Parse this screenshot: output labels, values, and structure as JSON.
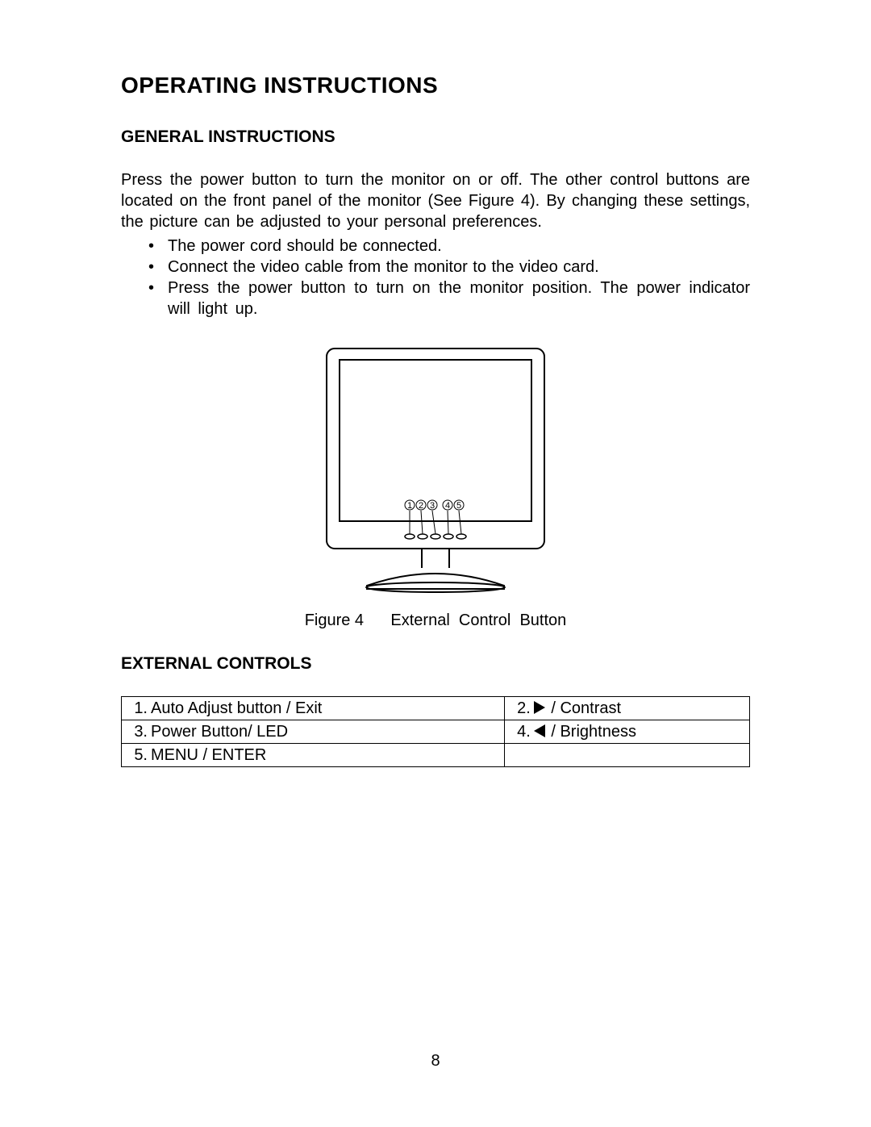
{
  "title": "OPERATING INSTRUCTIONS",
  "section1": {
    "heading": "GENERAL INSTRUCTIONS",
    "intro": "Press the power button to turn the monitor on or off. The other control buttons are located on the front panel of the monitor (See Figure 4). By changing these settings, the picture can be adjusted to your personal preferences.",
    "bullets": [
      "The power cord should be connected.",
      "Connect the video cable from the monitor to the video card.",
      "Press the power button to turn on the monitor position. The power indicator will light up."
    ]
  },
  "figure": {
    "caption": "Figure 4      External  Control  Button",
    "labels": [
      "1",
      "2",
      "3",
      "4",
      "5"
    ]
  },
  "section2": {
    "heading": "EXTERNAL CONTROLS",
    "rows": [
      {
        "n1": "1.",
        "l1": "Auto Adjust button / Exit",
        "n2": "2.",
        "icon2": "right",
        "l2": " / Contrast"
      },
      {
        "n1": "3.",
        "l1": "Power Button/ LED",
        "n2": "4.",
        "icon2": "left",
        "l2": " / Brightness"
      },
      {
        "n1": "5.",
        "l1": "MENU / ENTER",
        "n2": "",
        "icon2": "",
        "l2": ""
      }
    ]
  },
  "page_number": "8"
}
